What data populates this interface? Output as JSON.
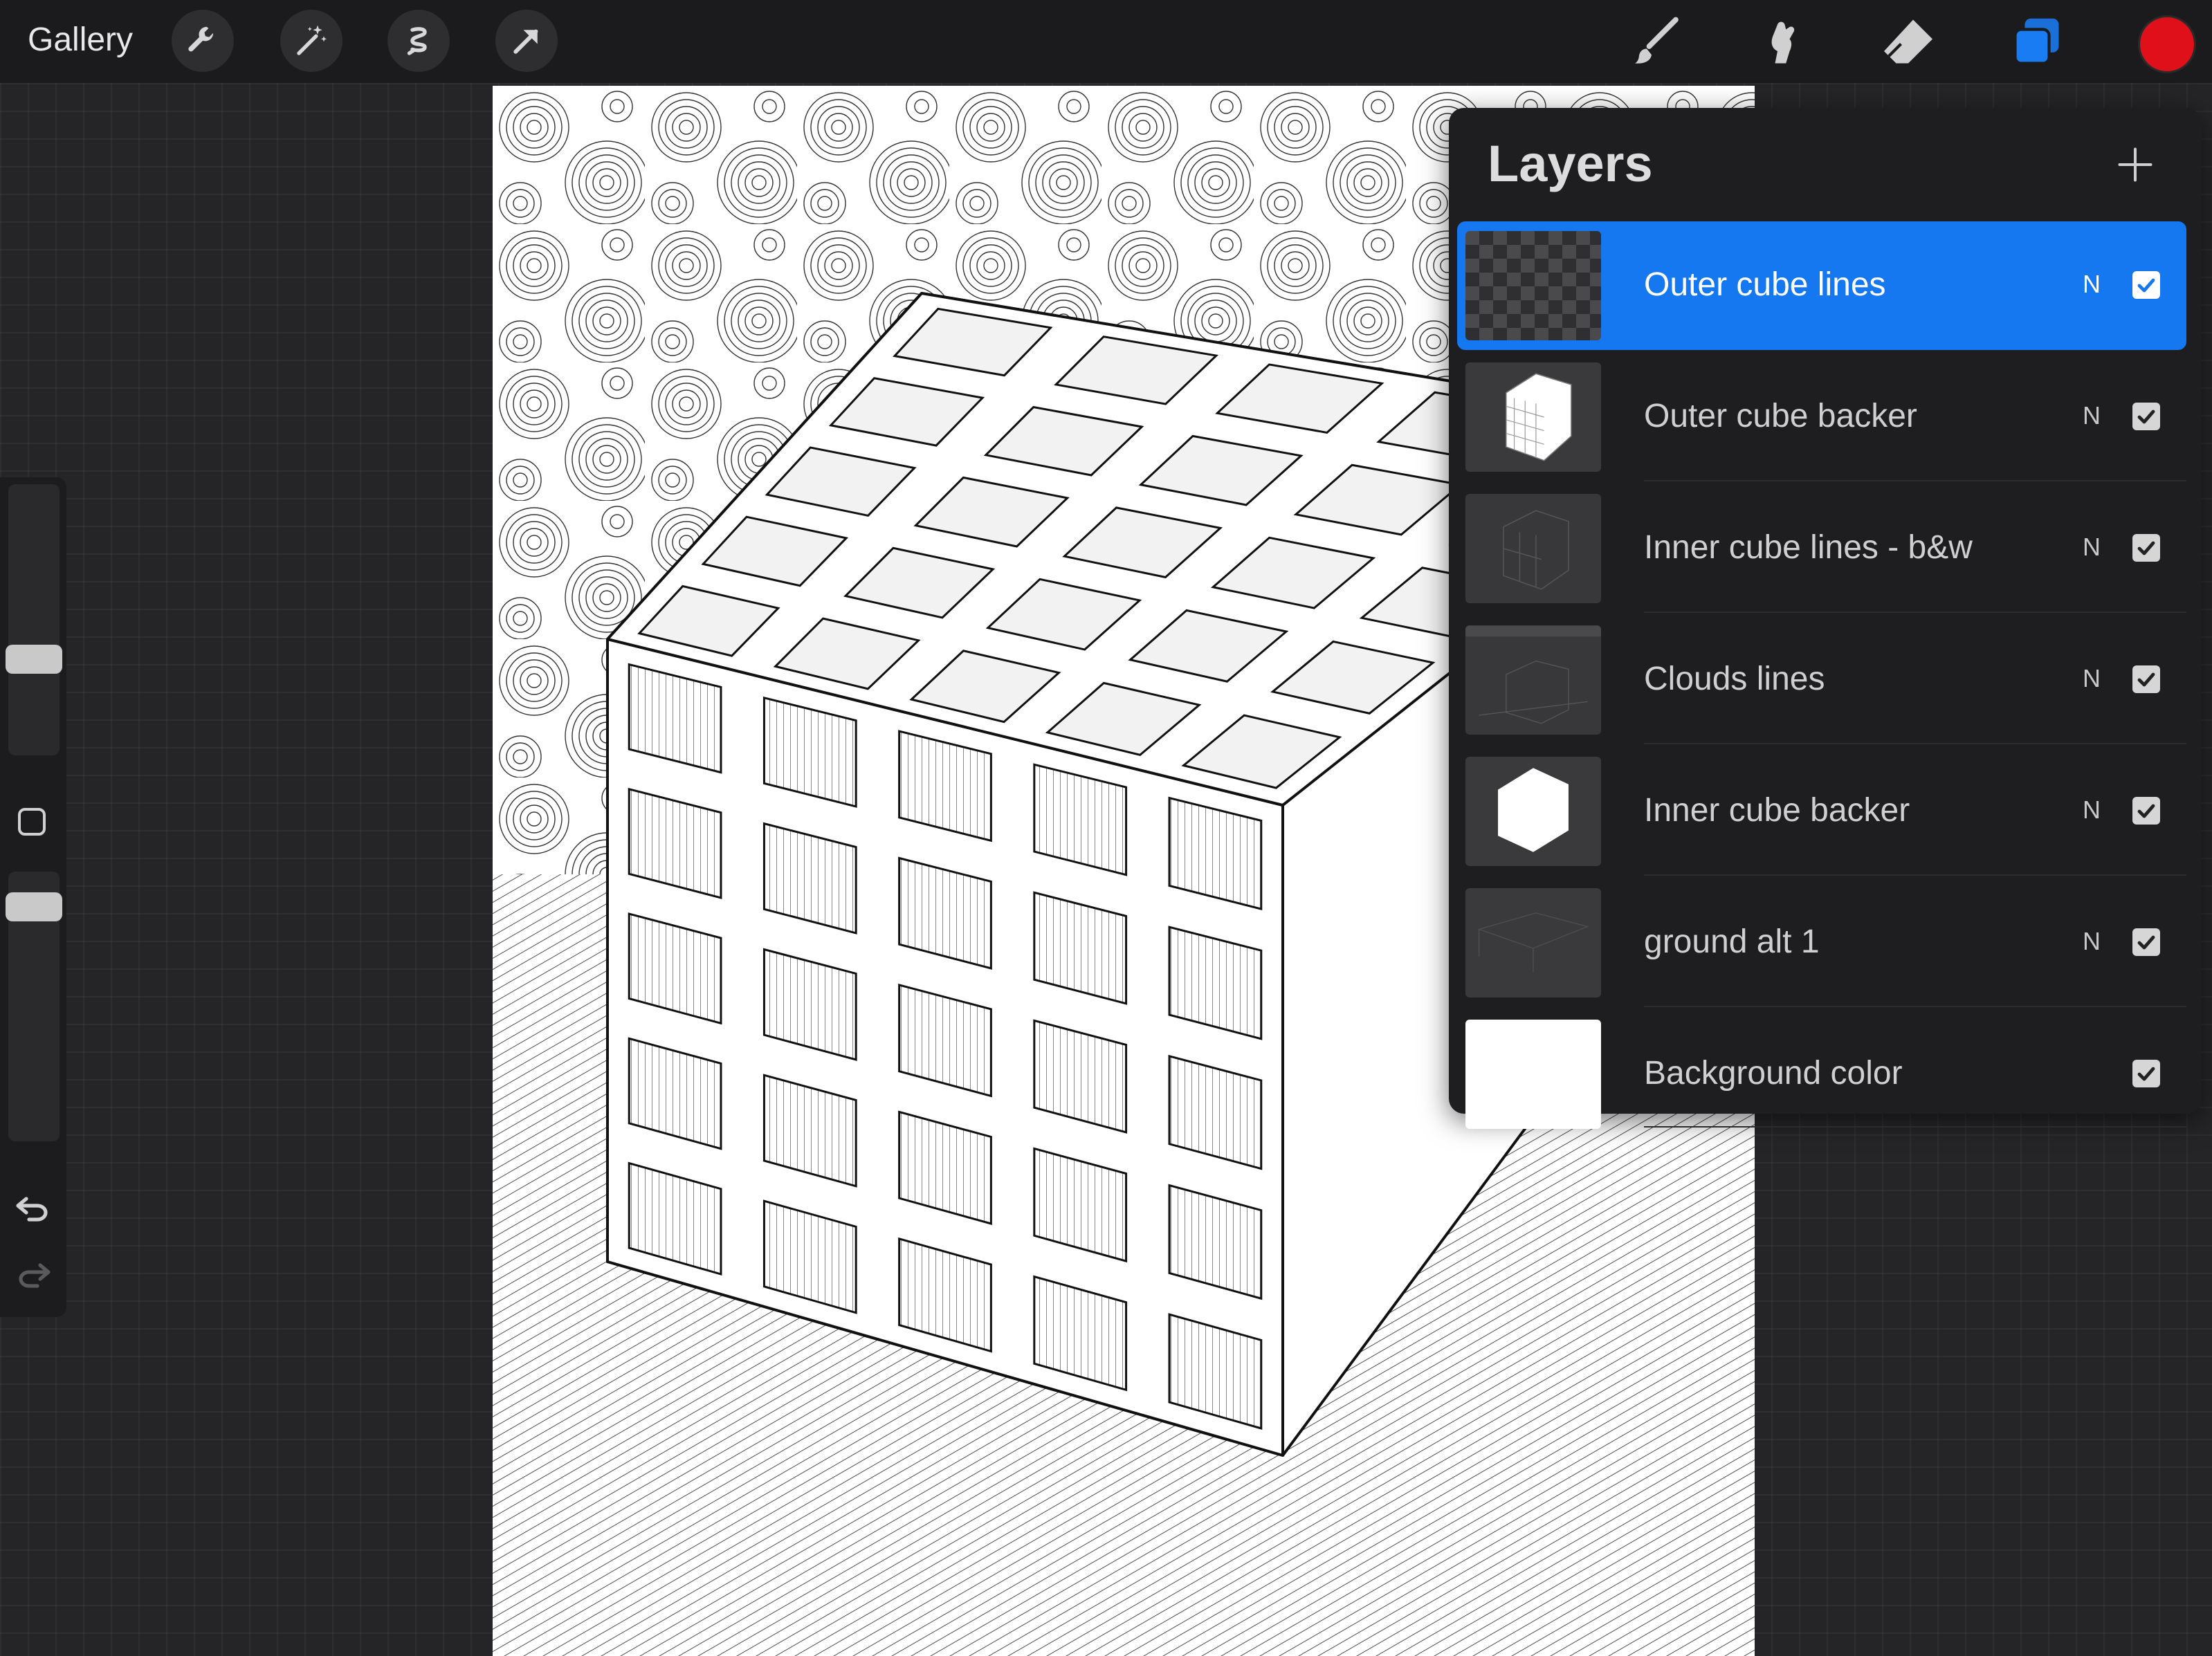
{
  "topbar": {
    "gallery_label": "Gallery",
    "tools_left": [
      "wrench-icon",
      "magic-wand-icon",
      "selection-icon",
      "transform-arrow-icon"
    ],
    "tools_right": [
      "brush-icon",
      "smudge-icon",
      "eraser-icon",
      "layers-icon"
    ],
    "active_tool": "layers-icon",
    "current_color": "#e0101a"
  },
  "sidebar": {
    "controls": [
      "brush-size-slider",
      "modify-button",
      "opacity-slider",
      "undo-icon",
      "redo-icon"
    ]
  },
  "layers_panel": {
    "title": "Layers",
    "add_icon": "plus-icon",
    "accent_color": "#1578f0",
    "layers": [
      {
        "name": "Outer cube lines",
        "blend": "N",
        "visible": true,
        "selected": true,
        "thumb": "transparent-checker"
      },
      {
        "name": "Outer cube backer",
        "blend": "N",
        "visible": true,
        "selected": false,
        "thumb": "white-grid-cube"
      },
      {
        "name": "Inner cube lines - b&w",
        "blend": "N",
        "visible": true,
        "selected": false,
        "thumb": "dark-cube-lines"
      },
      {
        "name": "Clouds lines",
        "blend": "N",
        "visible": true,
        "selected": false,
        "thumb": "dark-clouds"
      },
      {
        "name": "Inner cube backer",
        "blend": "N",
        "visible": true,
        "selected": false,
        "thumb": "white-hexagon"
      },
      {
        "name": "ground alt 1",
        "blend": "N",
        "visible": true,
        "selected": false,
        "thumb": "dark-ground"
      },
      {
        "name": "Background color",
        "blend": "",
        "visible": true,
        "selected": false,
        "thumb": "white-fill"
      }
    ]
  }
}
